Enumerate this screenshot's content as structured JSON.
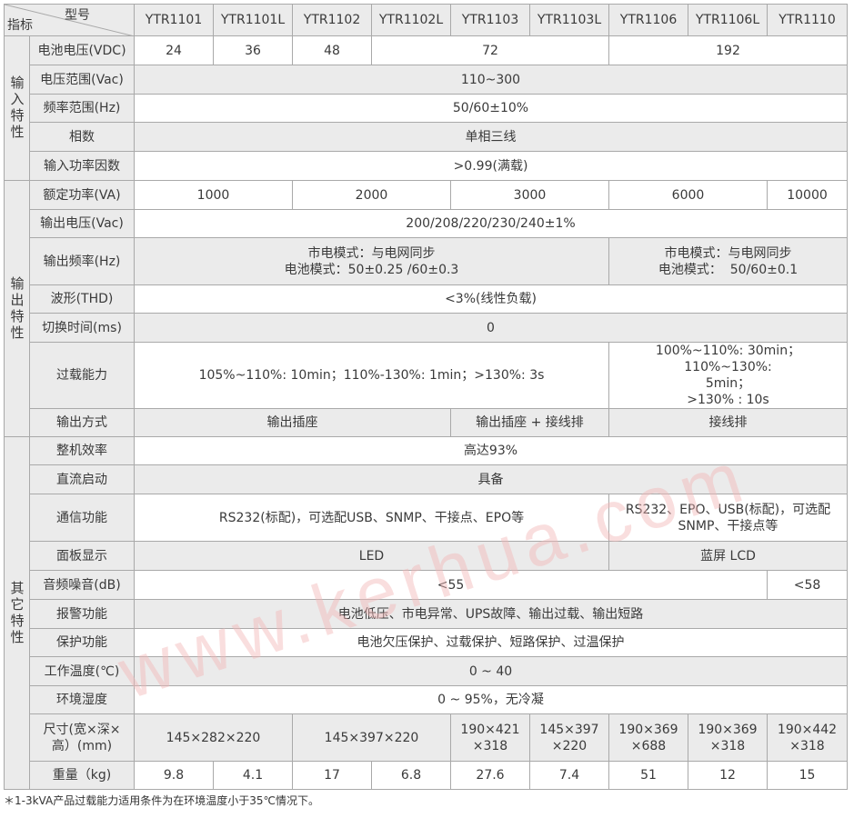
{
  "header": {
    "corner_top": "型号",
    "corner_bottom": "指标",
    "models": [
      "YTR1101",
      "YTR1101L",
      "YTR1102",
      "YTR1102L",
      "YTR1103",
      "YTR1103L",
      "YTR1106",
      "YTR1106L",
      "YTR1110"
    ]
  },
  "input": {
    "category": "输入特性",
    "voltage_label": "电池电压(VDC)",
    "voltage_values": [
      "24",
      "36",
      "48",
      "72",
      "192"
    ],
    "range_label": "电压范围(Vac)",
    "range_value": "110~300",
    "freq_label": "频率范围(Hz)",
    "freq_value": "50/60±10%",
    "phase_label": "相数",
    "phase_value": "单相三线",
    "pf_label": "输入功率因数",
    "pf_value": ">0.99(满载)"
  },
  "output": {
    "category": "输出特性",
    "power_label": "额定功率(VA)",
    "power_values": [
      "1000",
      "2000",
      "3000",
      "6000",
      "10000"
    ],
    "voltage_label": "输出电压(Vac)",
    "voltage_value": "200/208/220/230/240±1%",
    "freq_label": "输出频率(Hz)",
    "freq_a_line1": "市电模式：与电网同步",
    "freq_a_line2": "电池模式：50±0.25 /60±0.3",
    "freq_b_line1": "市电模式：与电网同步",
    "freq_b_line2": "电池模式：  50/60±0.1",
    "thd_label": "波形(THD)",
    "thd_value": "<3%(线性负载)",
    "switch_label": "切换时间(ms)",
    "switch_value": "0",
    "overload_label": "过载能力",
    "overload_a": "105%~110%: 10min；110%-130%: 1min；>130%: 3s",
    "overload_b_line1": "100%~110%: 30min；110%~130%:",
    "overload_b_line2": "5min；",
    "overload_b_line3": ">130% : 10s",
    "mode_label": "输出方式",
    "mode_values": [
      "输出插座",
      "输出插座 + 接线排",
      "接线排"
    ]
  },
  "other": {
    "category": "其它特性",
    "eff_label": "整机效率",
    "eff_value": "高达93%",
    "dc_label": "直流启动",
    "dc_value": "具备",
    "comm_label": "通信功能",
    "comm_a": "RS232(标配)，可选配USB、SNMP、干接点、EPO等",
    "comm_b_line1": "RS232、EPO、USB(标配)，可选配",
    "comm_b_line2": "SNMP、干接点等",
    "panel_label": "面板显示",
    "panel_values": [
      "LED",
      "蓝屏 LCD"
    ],
    "noise_label": "音频噪音(dB)",
    "noise_values": [
      "<55",
      "<58"
    ],
    "alarm_label": "报警功能",
    "alarm_value": "电池低压、市电异常、UPS故障、输出过载、输出短路",
    "protect_label": "保护功能",
    "protect_value": "电池欠压保护、过载保护、短路保护、过温保护",
    "temp_label": "工作温度(℃)",
    "temp_value": "0 ~ 40",
    "humid_label": "环境湿度",
    "humid_value": "0 ~ 95%，无冷凝",
    "size_label_line1": "尺寸(宽×深×",
    "size_label_line2": "高）(mm)",
    "size_values": [
      [
        "145×282×220"
      ],
      [
        "145×397×220"
      ],
      [
        "190×421",
        "×318"
      ],
      [
        "145×397",
        "×220"
      ],
      [
        "190×369",
        "×688"
      ],
      [
        "190×369",
        "×318"
      ],
      [
        "190×442",
        "×318"
      ]
    ],
    "weight_label": "重量（kg)",
    "weight_values": [
      "9.8",
      "4.1",
      "17",
      "6.8",
      "27.6",
      "7.4",
      "51",
      "12",
      "15"
    ]
  },
  "footnote": "＊1-3kVA产品过载能力适用条件为在环境温度小于35℃情况下。",
  "watermark": "www.kerhua.com"
}
